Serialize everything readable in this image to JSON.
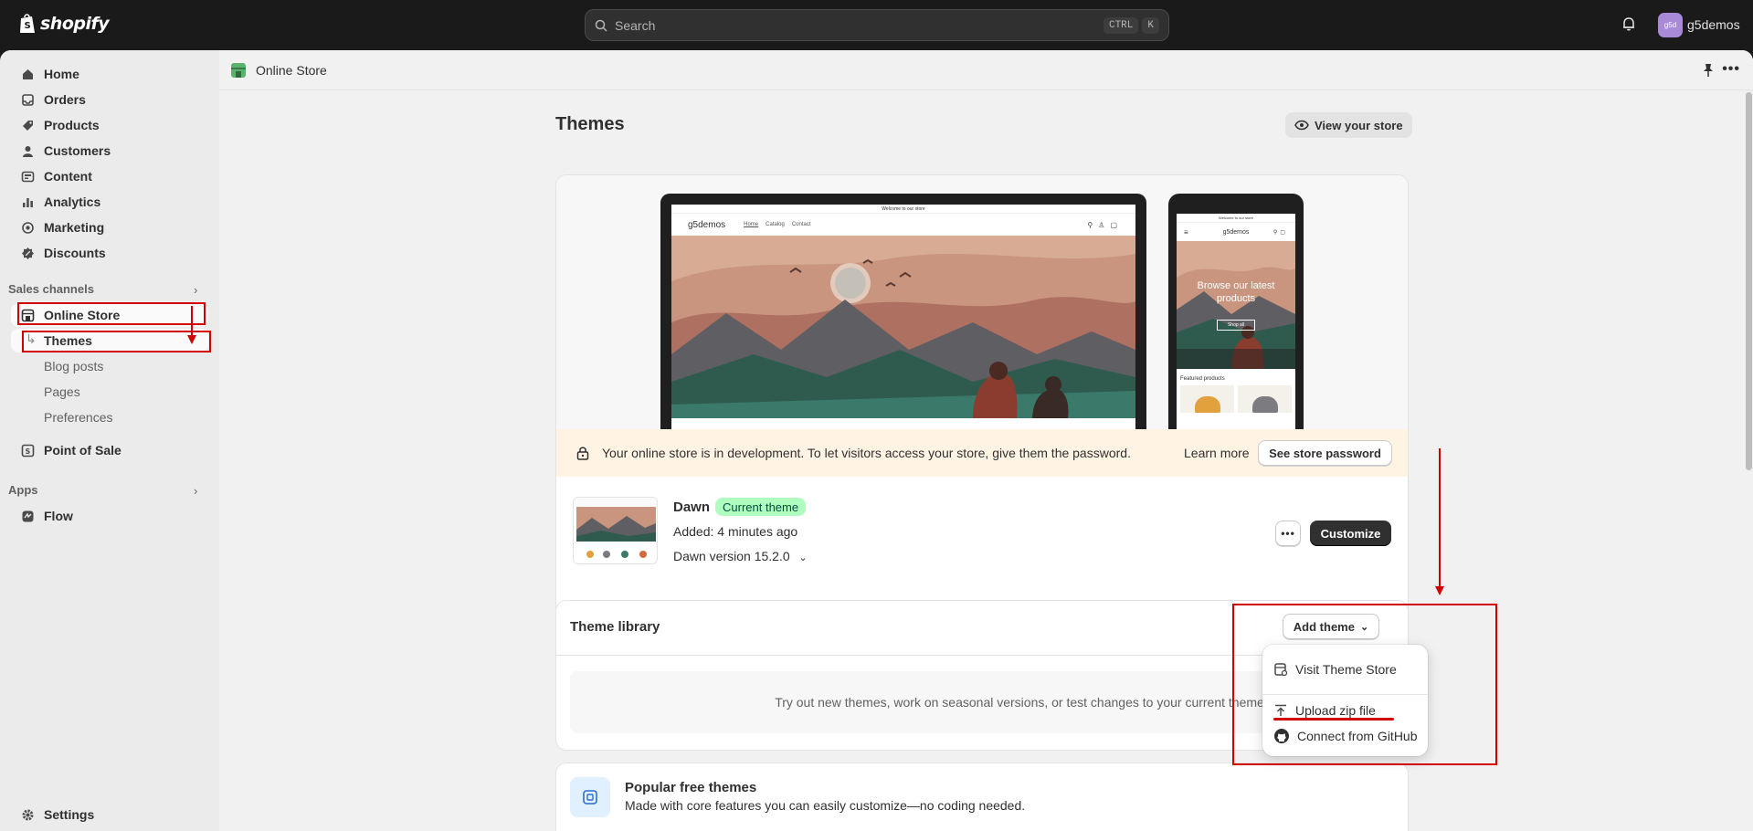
{
  "topbar": {
    "logo_text": "shopify",
    "search_placeholder": "Search",
    "shortcut_keys": [
      "CTRL",
      "K"
    ],
    "avatar_initials": "g5d",
    "store_name": "g5demos"
  },
  "sidebar": {
    "items": [
      {
        "label": "Home",
        "icon": "home-icon"
      },
      {
        "label": "Orders",
        "icon": "inbox-icon"
      },
      {
        "label": "Products",
        "icon": "tag-icon"
      },
      {
        "label": "Customers",
        "icon": "person-icon"
      },
      {
        "label": "Content",
        "icon": "image-icon"
      },
      {
        "label": "Analytics",
        "icon": "bar-chart-icon"
      },
      {
        "label": "Marketing",
        "icon": "target-icon"
      },
      {
        "label": "Discounts",
        "icon": "discount-icon"
      }
    ],
    "sales_channels_label": "Sales channels",
    "online_store": "Online Store",
    "online_store_subitems": [
      "Themes",
      "Blog posts",
      "Pages",
      "Preferences"
    ],
    "point_of_sale": "Point of Sale",
    "apps_label": "Apps",
    "flow": "Flow",
    "settings": "Settings"
  },
  "breadcrumb": {
    "title": "Online Store"
  },
  "page": {
    "title": "Themes",
    "view_store_label": "View your store"
  },
  "preview": {
    "announcement": "Welcome to our store",
    "store_logo": "g5demos",
    "nav": [
      "Home",
      "Catalog",
      "Contact"
    ],
    "phone_heading": "Browse our latest products",
    "phone_button": "Shop all",
    "phone_featured": "Featured products"
  },
  "banner": {
    "message": "Your online store is in development. To let visitors access your store, give them the password.",
    "learn_more": "Learn more",
    "button": "See store password"
  },
  "current_theme": {
    "name": "Dawn",
    "badge": "Current theme",
    "added": "Added: 4 minutes ago",
    "version": "Dawn version 15.2.0",
    "customize_label": "Customize"
  },
  "library": {
    "title": "Theme library",
    "add_theme_label": "Add theme",
    "empty_text": "Try out new themes, work on seasonal versions, or test changes to your current theme"
  },
  "add_theme_menu": {
    "items": [
      {
        "label": "Visit Theme Store",
        "icon": "store-icon"
      },
      {
        "label": "Upload zip file",
        "icon": "upload-icon"
      },
      {
        "label": "Connect from GitHub",
        "icon": "github-icon"
      }
    ]
  },
  "popular": {
    "title": "Popular free themes",
    "subtitle": "Made with core features you can easily customize—no coding needed."
  },
  "colors": {
    "topbar_bg": "#1a1a1a",
    "banner_bg": "#fff4e4",
    "badge_bg": "#affebf",
    "annotation_red": "#d30000",
    "primary_button": "#303030"
  }
}
